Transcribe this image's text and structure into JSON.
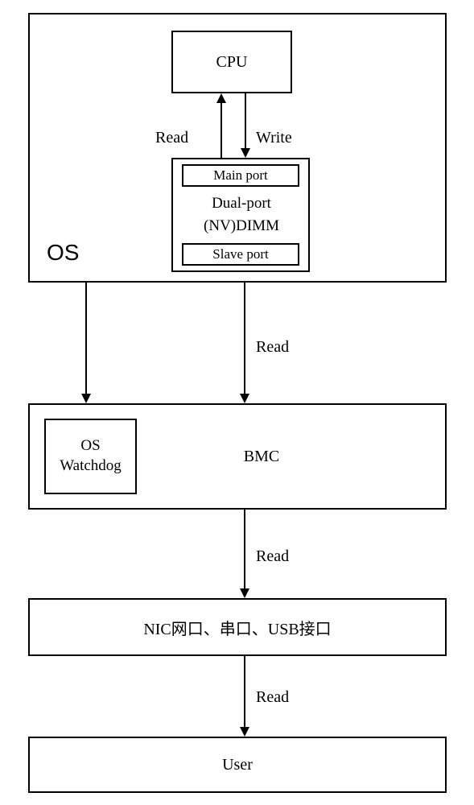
{
  "os_label": "OS",
  "cpu_label": "CPU",
  "read_label_cpu": "Read",
  "write_label_cpu": "Write",
  "main_port_label": "Main port",
  "dimm_label_line1": "Dual-port",
  "dimm_label_line2": "(NV)DIMM",
  "slave_port_label": "Slave port",
  "read_label_bmc": "Read",
  "bmc_label": "BMC",
  "watchdog_line1": "OS",
  "watchdog_line2": "Watchdog",
  "read_label_nic": "Read",
  "nic_label": "NIC网口、串口、USB接口",
  "read_label_user": "Read",
  "user_label": "User"
}
